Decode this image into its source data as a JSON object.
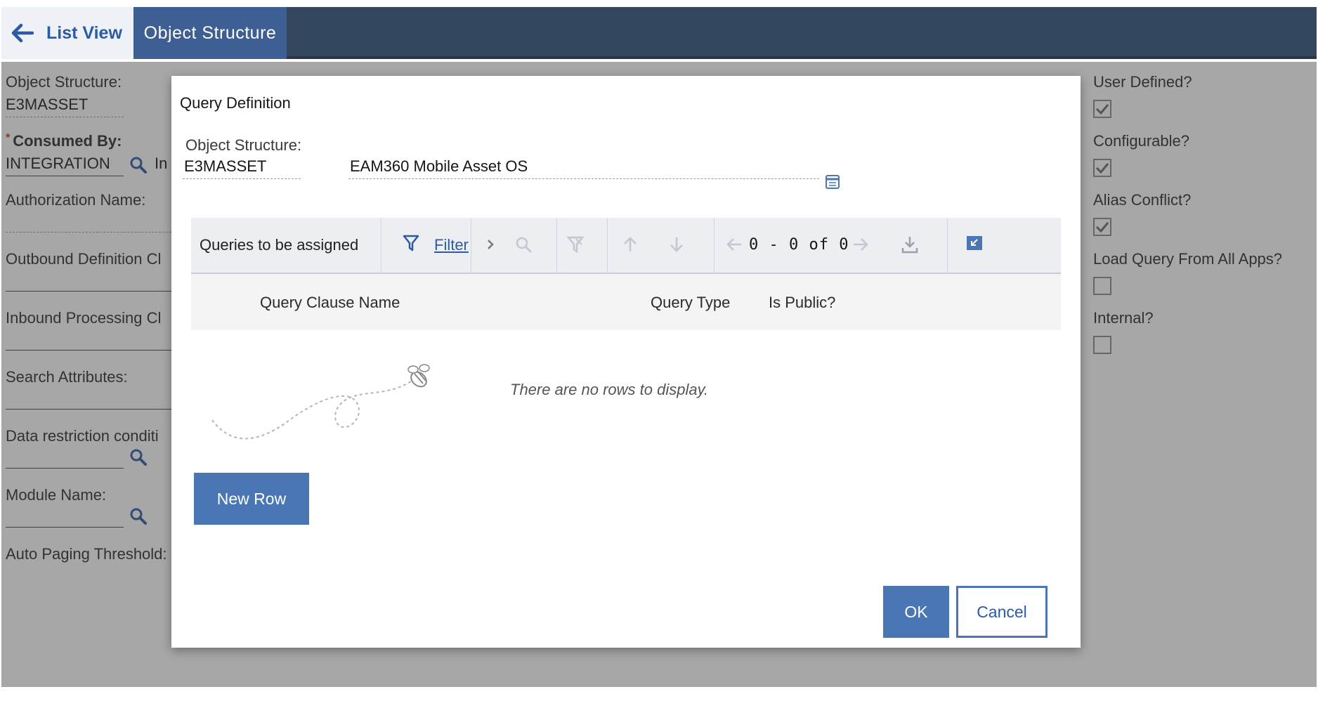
{
  "nav": {
    "back_label": "List View",
    "active_tab": "Object Structure"
  },
  "form": {
    "object_structure_label": "Object Structure:",
    "object_structure_value": "E3MASSET",
    "consumed_by_label": "Consumed By:",
    "consumed_by_value": "INTEGRATION",
    "consumed_by_extra": "In",
    "authorization_name_label": "Authorization Name:",
    "outbound_definition_label": "Outbound Definition Cl",
    "inbound_processing_label": "Inbound Processing Cl",
    "search_attributes_label": "Search Attributes:",
    "data_restriction_label": "Data restriction conditi",
    "module_name_label": "Module Name:",
    "auto_paging_label": "Auto Paging Threshold:"
  },
  "flags": {
    "user_defined": {
      "label": "User Defined?",
      "checked": true
    },
    "configurable": {
      "label": "Configurable?",
      "checked": true
    },
    "alias_conflict": {
      "label": "Alias Conflict?",
      "checked": true
    },
    "load_query": {
      "label": "Load Query From All Apps?",
      "checked": false
    },
    "internal": {
      "label": "Internal?",
      "checked": false
    }
  },
  "dialog": {
    "title": "Query Definition",
    "object_structure_label": "Object Structure:",
    "object_structure_value": "E3MASSET",
    "object_structure_desc": "EAM360 Mobile Asset OS",
    "table_title": "Queries to be assigned",
    "filter_label": "Filter",
    "pager_text": "0 - 0 of 0",
    "columns": [
      "Query Clause Name",
      "Query Type",
      "Is Public?"
    ],
    "empty_message": "There are no rows to display.",
    "new_row_label": "New Row",
    "ok_label": "OK",
    "cancel_label": "Cancel"
  },
  "colors": {
    "nav_bg": "#33475f",
    "accent": "#4a77b4",
    "link": "#2c5aa6"
  }
}
